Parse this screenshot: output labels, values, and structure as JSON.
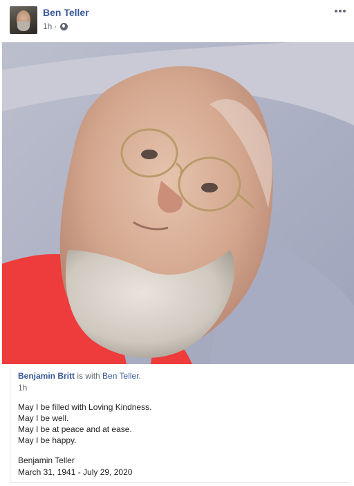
{
  "post": {
    "author": "Ben Teller",
    "timestamp": "1h",
    "separator": "·",
    "privacy_icon": "globe-icon",
    "more_icon": "more-options-icon"
  },
  "photo": {
    "description_icon": "portrait-photo"
  },
  "caption": {
    "actor": "Benjamin Britt",
    "with_text": "is with",
    "tagged": "Ben Teller",
    "period": ".",
    "time": "1h",
    "lines": [
      "May I be filled with Loving Kindness.",
      "May I be well.",
      "May I be at peace and at ease.",
      "May I be happy."
    ],
    "signature_name": "Benjamin Teller",
    "signature_dates": "March 31, 1941 - July 29, 2020"
  },
  "colors": {
    "link": "#385898",
    "meta": "#606770",
    "text": "#1c1e21"
  }
}
